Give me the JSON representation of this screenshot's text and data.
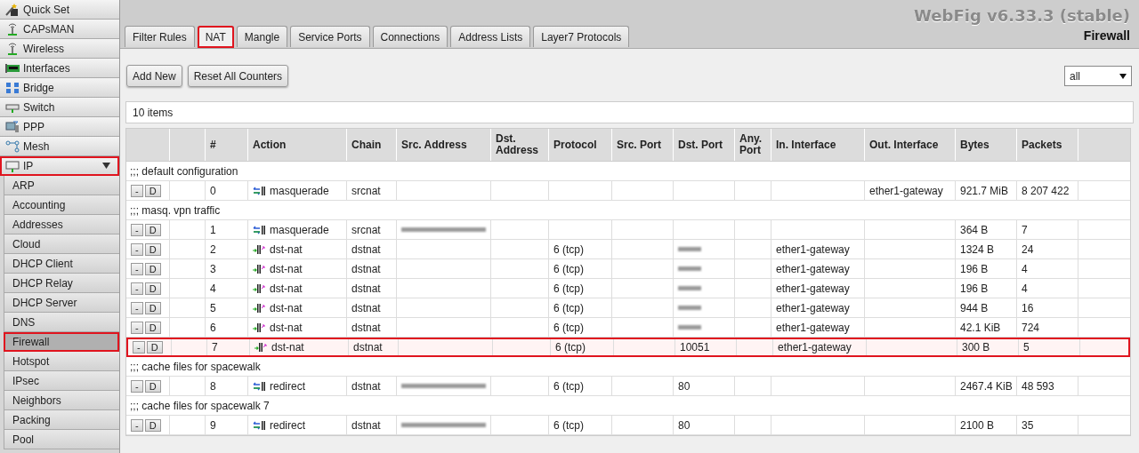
{
  "sidebar": {
    "items": [
      {
        "label": "Quick Set",
        "kind": "wand",
        "highlighted": false
      },
      {
        "label": "CAPsMAN",
        "kind": "antenna",
        "highlighted": false
      },
      {
        "label": "Wireless",
        "kind": "antenna",
        "highlighted": false
      },
      {
        "label": "Interfaces",
        "kind": "card",
        "highlighted": false
      },
      {
        "label": "Bridge",
        "kind": "bridge",
        "highlighted": false
      },
      {
        "label": "Switch",
        "kind": "switch",
        "highlighted": false
      },
      {
        "label": "PPP",
        "kind": "ppp",
        "highlighted": false
      },
      {
        "label": "Mesh",
        "kind": "mesh",
        "highlighted": false
      },
      {
        "label": "IP",
        "kind": "ip",
        "expanded": true,
        "highlighted": true,
        "children": [
          {
            "label": "ARP",
            "selected": false,
            "highlighted": false
          },
          {
            "label": "Accounting",
            "selected": false,
            "highlighted": false
          },
          {
            "label": "Addresses",
            "selected": false,
            "highlighted": false
          },
          {
            "label": "Cloud",
            "selected": false,
            "highlighted": false
          },
          {
            "label": "DHCP Client",
            "selected": false,
            "highlighted": false
          },
          {
            "label": "DHCP Relay",
            "selected": false,
            "highlighted": false
          },
          {
            "label": "DHCP Server",
            "selected": false,
            "highlighted": false
          },
          {
            "label": "DNS",
            "selected": false,
            "highlighted": false
          },
          {
            "label": "Firewall",
            "selected": true,
            "highlighted": true
          },
          {
            "label": "Hotspot",
            "selected": false,
            "highlighted": false
          },
          {
            "label": "IPsec",
            "selected": false,
            "highlighted": false
          },
          {
            "label": "Neighbors",
            "selected": false,
            "highlighted": false
          },
          {
            "label": "Packing",
            "selected": false,
            "highlighted": false
          },
          {
            "label": "Pool",
            "selected": false,
            "highlighted": false
          }
        ]
      }
    ]
  },
  "header": {
    "brand": "WebFig v6.33.3 (stable)",
    "section": "Firewall"
  },
  "tabs": [
    {
      "label": "Filter Rules",
      "selected": false,
      "highlighted": false
    },
    {
      "label": "NAT",
      "selected": true,
      "highlighted": true
    },
    {
      "label": "Mangle",
      "selected": false,
      "highlighted": false
    },
    {
      "label": "Service Ports",
      "selected": false,
      "highlighted": false
    },
    {
      "label": "Connections",
      "selected": false,
      "highlighted": false
    },
    {
      "label": "Address Lists",
      "selected": false,
      "highlighted": false
    },
    {
      "label": "Layer7 Protocols",
      "selected": false,
      "highlighted": false
    }
  ],
  "toolbar": {
    "buttons": [
      "Add New",
      "Reset All Counters"
    ],
    "filter": "all"
  },
  "item_count": "10 items",
  "table": {
    "columns": [
      "#",
      "Action",
      "Chain",
      "Src. Address",
      "Dst. Address",
      "Protocol",
      "Src. Port",
      "Dst. Port",
      "Any. Port",
      "In. Interface",
      "Out. Interface",
      "Bytes",
      "Packets"
    ],
    "rows": [
      {
        "kind": "comment",
        "text": ";;; default configuration"
      },
      {
        "kind": "rule",
        "buttons": [
          "-",
          "D"
        ],
        "number": "0",
        "action": {
          "kind": "swap",
          "label": "masquerade"
        },
        "highlighted": false,
        "cells": [
          "srcnat",
          "",
          "",
          "",
          "",
          "",
          "",
          "",
          "ether1-gateway",
          "921.7 MiB",
          "8 207 422"
        ]
      },
      {
        "kind": "comment",
        "text": ";;; masq. vpn traffic"
      },
      {
        "kind": "rule",
        "buttons": [
          "-",
          "D"
        ],
        "number": "1",
        "action": {
          "kind": "swap",
          "label": "masquerade"
        },
        "highlighted": false,
        "cells": [
          "srcnat",
          {
            "kind": "redacted"
          },
          "",
          "",
          "",
          "",
          "",
          "",
          "",
          "364 B",
          "7"
        ]
      },
      {
        "kind": "rule",
        "buttons": [
          "-",
          "D"
        ],
        "number": "2",
        "action": {
          "kind": "dstnat",
          "label": "dst-nat"
        },
        "highlighted": false,
        "cells": [
          "dstnat",
          "",
          "",
          "6 (tcp)",
          "",
          {
            "kind": "redacted"
          },
          "",
          "ether1-gateway",
          "",
          "1324 B",
          "24"
        ]
      },
      {
        "kind": "rule",
        "buttons": [
          "-",
          "D"
        ],
        "number": "3",
        "action": {
          "kind": "dstnat",
          "label": "dst-nat"
        },
        "highlighted": false,
        "cells": [
          "dstnat",
          "",
          "",
          "6 (tcp)",
          "",
          {
            "kind": "redacted"
          },
          "",
          "ether1-gateway",
          "",
          "196 B",
          "4"
        ]
      },
      {
        "kind": "rule",
        "buttons": [
          "-",
          "D"
        ],
        "number": "4",
        "action": {
          "kind": "dstnat",
          "label": "dst-nat"
        },
        "highlighted": false,
        "cells": [
          "dstnat",
          "",
          "",
          "6 (tcp)",
          "",
          {
            "kind": "redacted"
          },
          "",
          "ether1-gateway",
          "",
          "196 B",
          "4"
        ]
      },
      {
        "kind": "rule",
        "buttons": [
          "-",
          "D"
        ],
        "number": "5",
        "action": {
          "kind": "dstnat",
          "label": "dst-nat"
        },
        "highlighted": false,
        "cells": [
          "dstnat",
          "",
          "",
          "6 (tcp)",
          "",
          {
            "kind": "redacted"
          },
          "",
          "ether1-gateway",
          "",
          "944 B",
          "16"
        ]
      },
      {
        "kind": "rule",
        "buttons": [
          "-",
          "D"
        ],
        "number": "6",
        "action": {
          "kind": "dstnat",
          "label": "dst-nat"
        },
        "highlighted": false,
        "cells": [
          "dstnat",
          "",
          "",
          "6 (tcp)",
          "",
          {
            "kind": "redacted"
          },
          "",
          "ether1-gateway",
          "",
          "42.1 KiB",
          "724"
        ]
      },
      {
        "kind": "rule",
        "buttons": [
          "-",
          "D"
        ],
        "number": "7",
        "action": {
          "kind": "dstnat",
          "label": "dst-nat"
        },
        "highlighted": true,
        "cells": [
          "dstnat",
          "",
          "",
          "6 (tcp)",
          "",
          "10051",
          "",
          "ether1-gateway",
          "",
          "300 B",
          "5"
        ]
      },
      {
        "kind": "comment",
        "text": ";;; cache files for spacewalk"
      },
      {
        "kind": "rule",
        "buttons": [
          "-",
          "D"
        ],
        "number": "8",
        "action": {
          "kind": "swap",
          "label": "redirect"
        },
        "highlighted": false,
        "cells": [
          "dstnat",
          {
            "kind": "redacted"
          },
          "",
          "6 (tcp)",
          "",
          "80",
          "",
          "",
          "",
          "2467.4 KiB",
          "48 593"
        ]
      },
      {
        "kind": "comment",
        "text": ";;; cache files for spacewalk 7"
      },
      {
        "kind": "rule",
        "buttons": [
          "-",
          "D"
        ],
        "number": "9",
        "action": {
          "kind": "swap",
          "label": "redirect"
        },
        "highlighted": false,
        "cells": [
          "dstnat",
          {
            "kind": "redacted"
          },
          "",
          "6 (tcp)",
          "",
          "80",
          "",
          "",
          "",
          "2100 B",
          "35"
        ]
      }
    ]
  }
}
